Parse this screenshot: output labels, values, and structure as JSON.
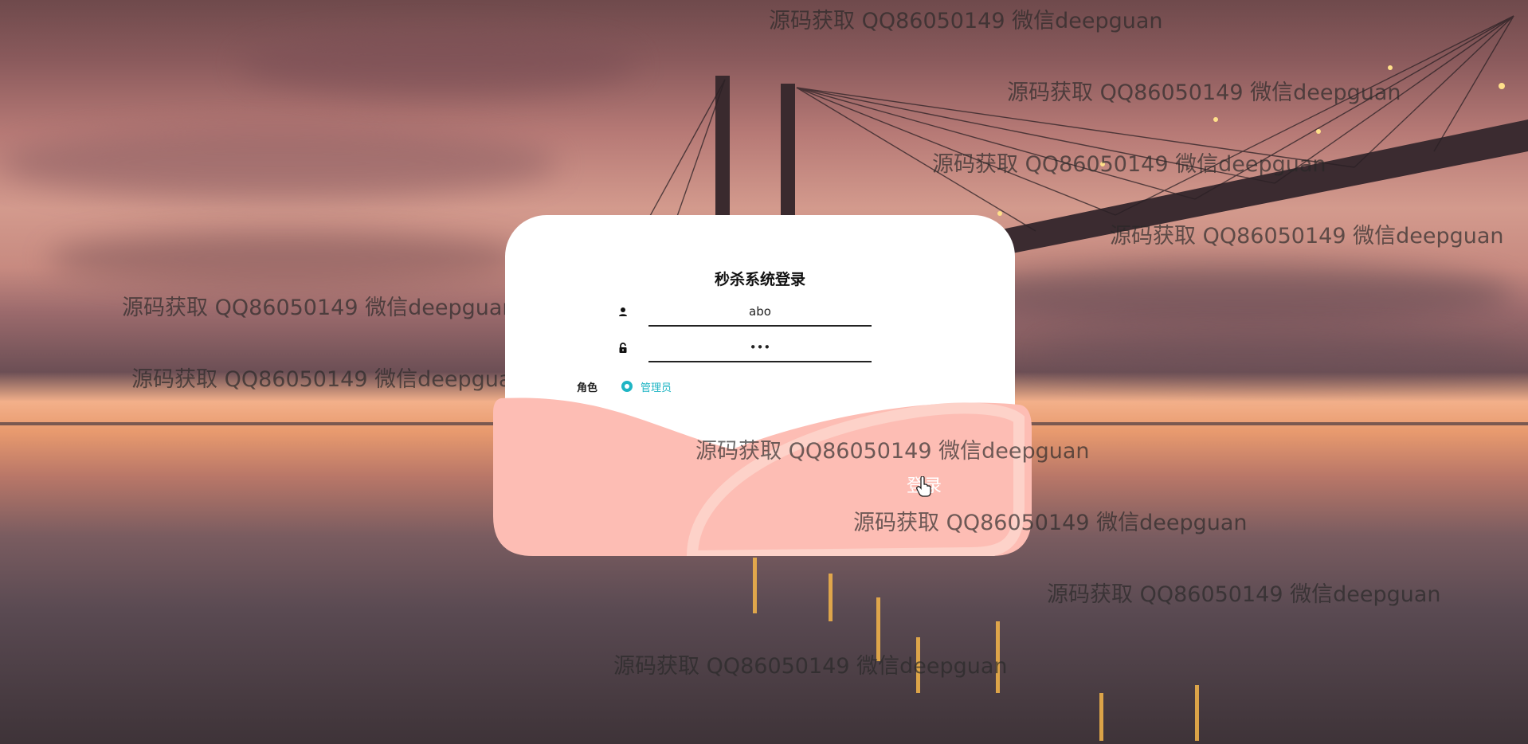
{
  "login": {
    "title": "秒杀系统登录",
    "username_value": "abo",
    "password_value": "•••",
    "role_label": "角色",
    "role_option": "管理员",
    "submit_label": "登录"
  },
  "watermarks": [
    "源码获取 QQ86050149 微信deepguan",
    "源码获取 QQ86050149 微信deepguan",
    "源码获取 QQ86050149 微信deepguan",
    "源码获取 QQ86050149 微信deepguan",
    "源码获取 QQ86050149 微信deepguan",
    "源码获取 QQ86050149 微信deepguan",
    "源码获取 QQ86050149 微信deepguan",
    "源码获取 QQ86050149 微信deepguan",
    "源码获取 QQ86050149 微信deepguan",
    "源码获取 QQ86050149 微信deepguan"
  ],
  "colors": {
    "accent": "#1fb5c4",
    "panel_pink": "#fdbdb4",
    "panel_curve": "#fdd2c9"
  },
  "icons": {
    "user": "user-icon",
    "lock": "lock-icon",
    "cursor": "hand-pointer-icon"
  }
}
